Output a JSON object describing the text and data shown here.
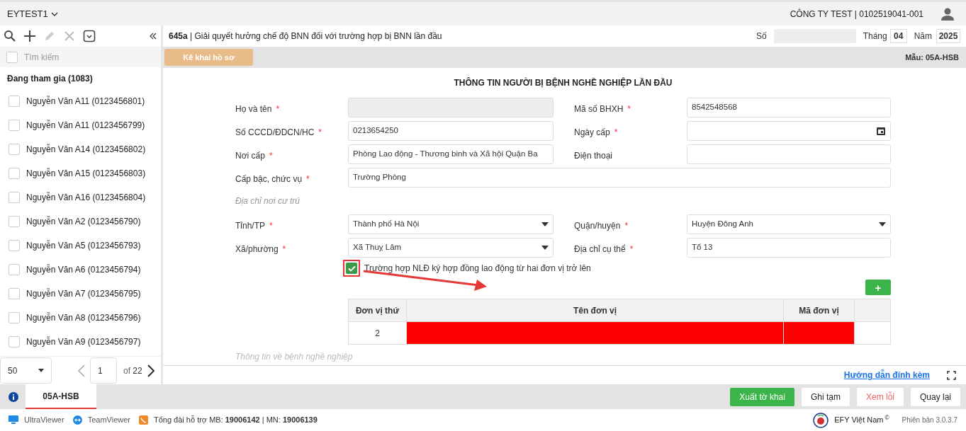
{
  "top_bar": {
    "account": "EYTEST1",
    "company": "CÔNG TY TEST | 0102519041-001"
  },
  "sidebar": {
    "select_all_checked": false,
    "search_placeholder": "Tìm kiếm",
    "group": "Đang tham gia (1083)",
    "items": [
      {
        "label": "Nguyễn Văn A11 (0123456801)",
        "checked": false
      },
      {
        "label": "Nguyễn Văn A11 (0123456799)",
        "checked": false
      },
      {
        "label": "Nguyễn Văn A14 (0123456802)",
        "checked": false
      },
      {
        "label": "Nguyễn Văn A15 (0123456803)",
        "checked": false
      },
      {
        "label": "Nguyễn Văn A16 (0123456804)",
        "checked": false
      },
      {
        "label": "Nguyễn Văn A2 (0123456790)",
        "checked": false
      },
      {
        "label": "Nguyễn Văn A5 (0123456793)",
        "checked": false
      },
      {
        "label": "Nguyễn Văn A6 (0123456794)",
        "checked": false
      },
      {
        "label": "Nguyễn Văn A7 (0123456795)",
        "checked": false
      },
      {
        "label": "Nguyễn Văn A8 (0123456796)",
        "checked": false
      },
      {
        "label": "Nguyễn Văn A9 (0123456797)",
        "checked": false
      }
    ],
    "page_size": "50",
    "page": "1",
    "of": "of",
    "page_total": "22"
  },
  "form": {
    "code": "645a",
    "title": " | Giải quyết hưởng chế độ BNN đối với trường hợp bị BNN lần đầu",
    "number_label": "Số",
    "month_label": "Tháng",
    "month": "04",
    "year_label": "Năm",
    "year": "2025",
    "declare_button": "Kê khai hồ sơ",
    "template": "Mẫu: 05A-HSB",
    "heading": "THÔNG TIN NGƯỜI BỊ BỆNH NGHỀ NGHIỆP LẦN ĐẦU",
    "rows": [
      {
        "kind": "fields",
        "fields": [
          {
            "label": "Họ và tên",
            "required_mark": "*",
            "kind": "text",
            "disabled": true
          },
          {
            "label": "Mã số BHXH",
            "required_mark": "*",
            "kind": "text",
            "disabled": false,
            "value": "8542548568"
          }
        ]
      },
      {
        "kind": "fields",
        "fields": [
          {
            "label": "Số CCCD/ĐDCN/HC",
            "required_mark": "*",
            "kind": "text",
            "disabled": false,
            "value": "0213654250"
          },
          {
            "label": "Ngày cấp",
            "required_mark": "*",
            "kind": "date",
            "disabled": false
          }
        ]
      },
      {
        "kind": "fields",
        "fields": [
          {
            "label": "Nơi cấp",
            "required_mark": "*",
            "kind": "text",
            "disabled": false,
            "value": "Phòng Lao động - Thương binh và Xã hội Quận Ba"
          },
          {
            "label": "Điện thoại",
            "kind": "text",
            "disabled": false
          }
        ]
      },
      {
        "kind": "wide",
        "fields": [
          {
            "label": "Cấp bậc, chức vụ",
            "required_mark": "*",
            "kind": "text",
            "disabled": false,
            "value": "Trường Phòng"
          }
        ]
      },
      {
        "kind": "section",
        "label": "Địa chỉ nơi cư trú"
      },
      {
        "kind": "fields",
        "fields": [
          {
            "label": "Tỉnh/TP",
            "required_mark": "*",
            "kind": "select",
            "disabled": false,
            "value": "Thành phố Hà Nội"
          },
          {
            "label": "Quận/huyện",
            "required_mark": "*",
            "kind": "select",
            "disabled": false,
            "value": "Huyện Đông Anh"
          }
        ]
      },
      {
        "kind": "fields",
        "fields": [
          {
            "label": "Xã/phường",
            "required_mark": "*",
            "kind": "select",
            "disabled": false,
            "value": "Xã Thuỵ Lâm"
          },
          {
            "label": "Địa chỉ cụ thể",
            "required_mark": "*",
            "kind": "text",
            "disabled": false,
            "value": "Tổ 13"
          }
        ]
      }
    ],
    "multi_employer": {
      "label": "Trường hợp NLĐ ký hợp đồng lao động từ hai đơn vị trở lên",
      "checked": true
    },
    "add_button": "+",
    "table": {
      "columns": [
        "Đơn vị thứ",
        "Tên đơn vị",
        "Mã đơn vị"
      ],
      "rows": [
        {
          "index": "2",
          "error": true
        }
      ]
    },
    "next_section": "Thông tin về bệnh nghề nghiệp",
    "guide_link": "Hướng dẫn đính kèm"
  },
  "tabs": [
    {
      "label": "05A-HSB",
      "selected": true
    }
  ],
  "actions": [
    {
      "label": "Xuất tờ khai",
      "kind": "primary"
    },
    {
      "label": "Ghi tạm",
      "kind": "default"
    },
    {
      "label": "Xem lỗi",
      "kind": "danger"
    },
    {
      "label": "Quay lại",
      "kind": "default"
    }
  ],
  "status_bar": {
    "links": [
      {
        "label": "UltraViewer",
        "kind": "ultraviewer"
      },
      {
        "label": "TeamViewer",
        "kind": "teamviewer"
      }
    ],
    "support": "Tổng đài hỗ trợ MB: **19006142** | MN: **19006139**",
    "vendor": "EFY Việt Nam",
    "copyright": "©",
    "version": "Phiên bản 3.0.3.7"
  }
}
